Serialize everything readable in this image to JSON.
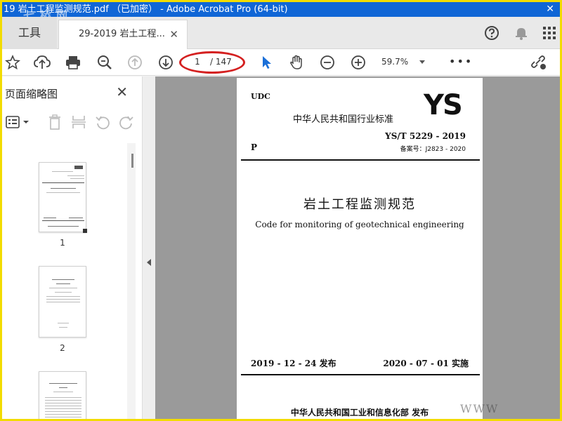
{
  "window": {
    "title": "19 岩土工程监测规范.pdf （已加密） - Adobe Acrobat Pro (64-bit)",
    "watermark": "七 桥 网",
    "close_glyph": "✕"
  },
  "tabs": {
    "tools_label": "工具",
    "doc_label": "29-2019 岩土工程...",
    "close_glyph": "✕"
  },
  "toolbar": {
    "current_page": "1",
    "total_pages": "/ 147",
    "zoom": "59.7%",
    "more": "•••"
  },
  "left_panel": {
    "title": "页面缩略图",
    "close_glyph": "✕",
    "thumbnails": [
      {
        "label": "1"
      },
      {
        "label": "2"
      },
      {
        "label": ""
      }
    ]
  },
  "document": {
    "udc": "UDC",
    "logo": "YS",
    "standard_name": "中华人民共和国行业标准",
    "standard_no": "YS/T 5229 - 2019",
    "p_letter": "P",
    "record_no": "备案号：J2823 - 2020",
    "title_cn": "岩土工程监测规范",
    "title_en": "Code for monitoring of geotechnical engineering",
    "issue_date": "2019 - 12 - 24 发布",
    "implement_date": "2020 - 07 - 01 实施",
    "publisher": "中华人民共和国工业和信息化部 发布"
  },
  "bottom_watermark": "WWW"
}
